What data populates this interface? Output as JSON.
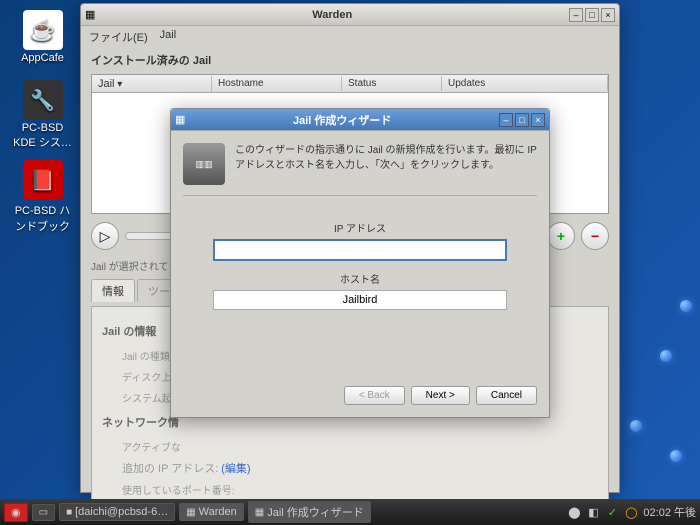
{
  "desktop": {
    "icons": [
      {
        "label": "AppCafe",
        "glyph": "☕"
      },
      {
        "label": "PC-BSD KDE シス…",
        "glyph": "🔧"
      },
      {
        "label": "PC-BSD ハンドブック",
        "glyph": "📕"
      }
    ]
  },
  "warden": {
    "title": "Warden",
    "menu": {
      "file": "ファイル(E)",
      "jail": "Jail"
    },
    "section": "インストール済みの Jail",
    "cols": {
      "jail": "Jail",
      "host": "Hostname",
      "status": "Status",
      "updates": "Updates"
    },
    "status": "Jail が選択されてい",
    "tabs": {
      "info": "情報",
      "tools": "ツール"
    },
    "panel": {
      "h1": "Jail の情報",
      "r1": "Jail の種類",
      "r2": "ディスク上の",
      "r3": "システム起動",
      "h2": "ネットワーク情",
      "r4": "アクティブな",
      "r5": "追加の IP アドレス:",
      "r5l": "(編集)",
      "r6": "使用しているポート番号:"
    }
  },
  "wizard": {
    "title": "Jail 作成ウィザード",
    "intro": "このウィザードの指示通りに Jail の新規作成を行います。最初に IP アドレスとホスト名を入力し、「次へ」をクリックします。",
    "ip_label": "IP アドレス",
    "ip_val": "",
    "host_label": "ホスト名",
    "host_val": "Jailbird",
    "back": "< Back",
    "next": "Next >",
    "cancel": "Cancel"
  },
  "taskbar": {
    "start": "◉",
    "term": "[daichi@pcbsd-6…",
    "w1": "Warden",
    "w2": "Jail 作成ウィザード",
    "clock": "02:02 午後"
  }
}
